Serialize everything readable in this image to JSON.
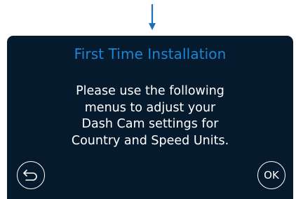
{
  "dialog": {
    "title": "First Time Installation",
    "message_lines": [
      "Please use the following",
      "menus to adjust your",
      "Dash Cam settings for",
      "Country and Speed Units."
    ]
  },
  "buttons": {
    "back_icon": "return-arrow-icon",
    "ok_label": "OK"
  },
  "indicator": {
    "icon": "down-arrow-icon"
  },
  "colors": {
    "screen_background": "#061a2e",
    "title": "#1a86d6",
    "indicator_arrow": "#1e6fb8",
    "text": "#ffffff"
  }
}
